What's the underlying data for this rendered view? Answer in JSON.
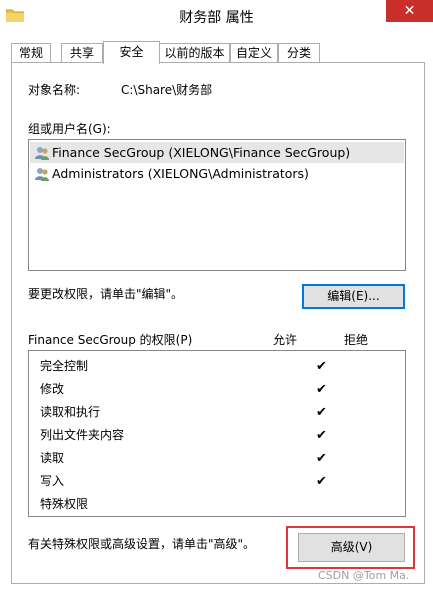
{
  "window": {
    "title": "财务部 属性",
    "close_label": "✕"
  },
  "tabs": [
    {
      "label": "常规"
    },
    {
      "label": "共享"
    },
    {
      "label": "安全"
    },
    {
      "label": "以前的版本"
    },
    {
      "label": "自定义"
    },
    {
      "label": "分类"
    }
  ],
  "security": {
    "object_label": "对象名称:",
    "object_value": "C:\\Share\\财务部",
    "groups_label": "组或用户名(G):",
    "groups": [
      {
        "name": "Finance SecGroup (XIELONG\\Finance SecGroup)",
        "icon": "group-icon"
      },
      {
        "name": "Administrators (XIELONG\\Administrators)",
        "icon": "group-icon"
      }
    ],
    "change_hint": "要更改权限，请单击\"编辑\"。",
    "edit_label": "编辑(E)...",
    "perm_header": "Finance SecGroup 的权限(P)",
    "allow_label": "允许",
    "deny_label": "拒绝",
    "permissions": [
      {
        "name": "完全控制",
        "allow": "✔"
      },
      {
        "name": "修改",
        "allow": "✔"
      },
      {
        "name": "读取和执行",
        "allow": "✔"
      },
      {
        "name": "列出文件夹内容",
        "allow": "✔"
      },
      {
        "name": "读取",
        "allow": "✔"
      },
      {
        "name": "写入",
        "allow": "✔"
      },
      {
        "name": "特殊权限",
        "allow": ""
      }
    ],
    "advanced_hint": "有关特殊权限或高级设置，请单击\"高级\"。",
    "advanced_label": "高级(V)"
  },
  "watermark": "CSDN @Tom Ma."
}
